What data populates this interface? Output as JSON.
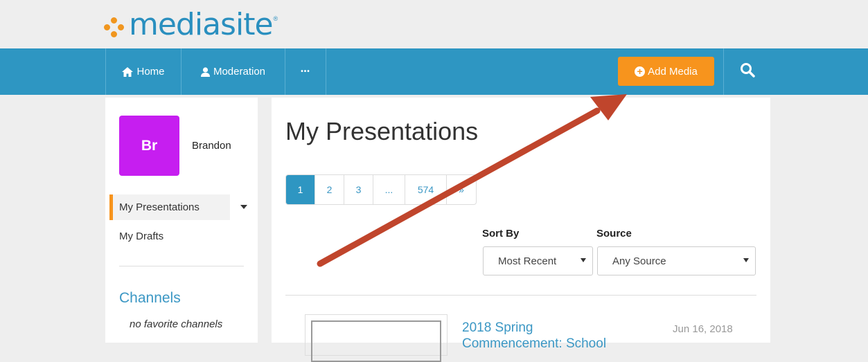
{
  "logo": {
    "text": "mediasite",
    "reg": "®"
  },
  "nav": {
    "items": [
      {
        "label": "Home",
        "icon": "home-icon"
      },
      {
        "label": "Moderation",
        "icon": "user-icon"
      },
      {
        "label": "•••",
        "icon": "more-icon"
      }
    ],
    "add_media_label": "Add Media",
    "search_icon": "search-icon"
  },
  "sidebar": {
    "avatar_initials": "Br",
    "user_name": "Brandon",
    "links": [
      {
        "label": "My Presentations",
        "active": true
      },
      {
        "label": "My Drafts",
        "active": false
      }
    ],
    "channels_title": "Channels",
    "no_favorites": "no favorite channels"
  },
  "main": {
    "title": "My Presentations",
    "pagination": [
      "1",
      "2",
      "3",
      "...",
      "574",
      "»"
    ],
    "current_page": "1",
    "sort_by": {
      "label": "Sort By",
      "value": "Most Recent"
    },
    "source": {
      "label": "Source",
      "value": "Any Source"
    },
    "presentation": {
      "title": "2018 Spring Commencement: School",
      "date": "Jun 16, 2018"
    }
  },
  "colors": {
    "nav_blue": "#2e96c2",
    "accent_orange": "#f7941d",
    "avatar_purple": "#c61ef0",
    "link_blue": "#3b97c4",
    "annotation_red": "#c0452c"
  }
}
